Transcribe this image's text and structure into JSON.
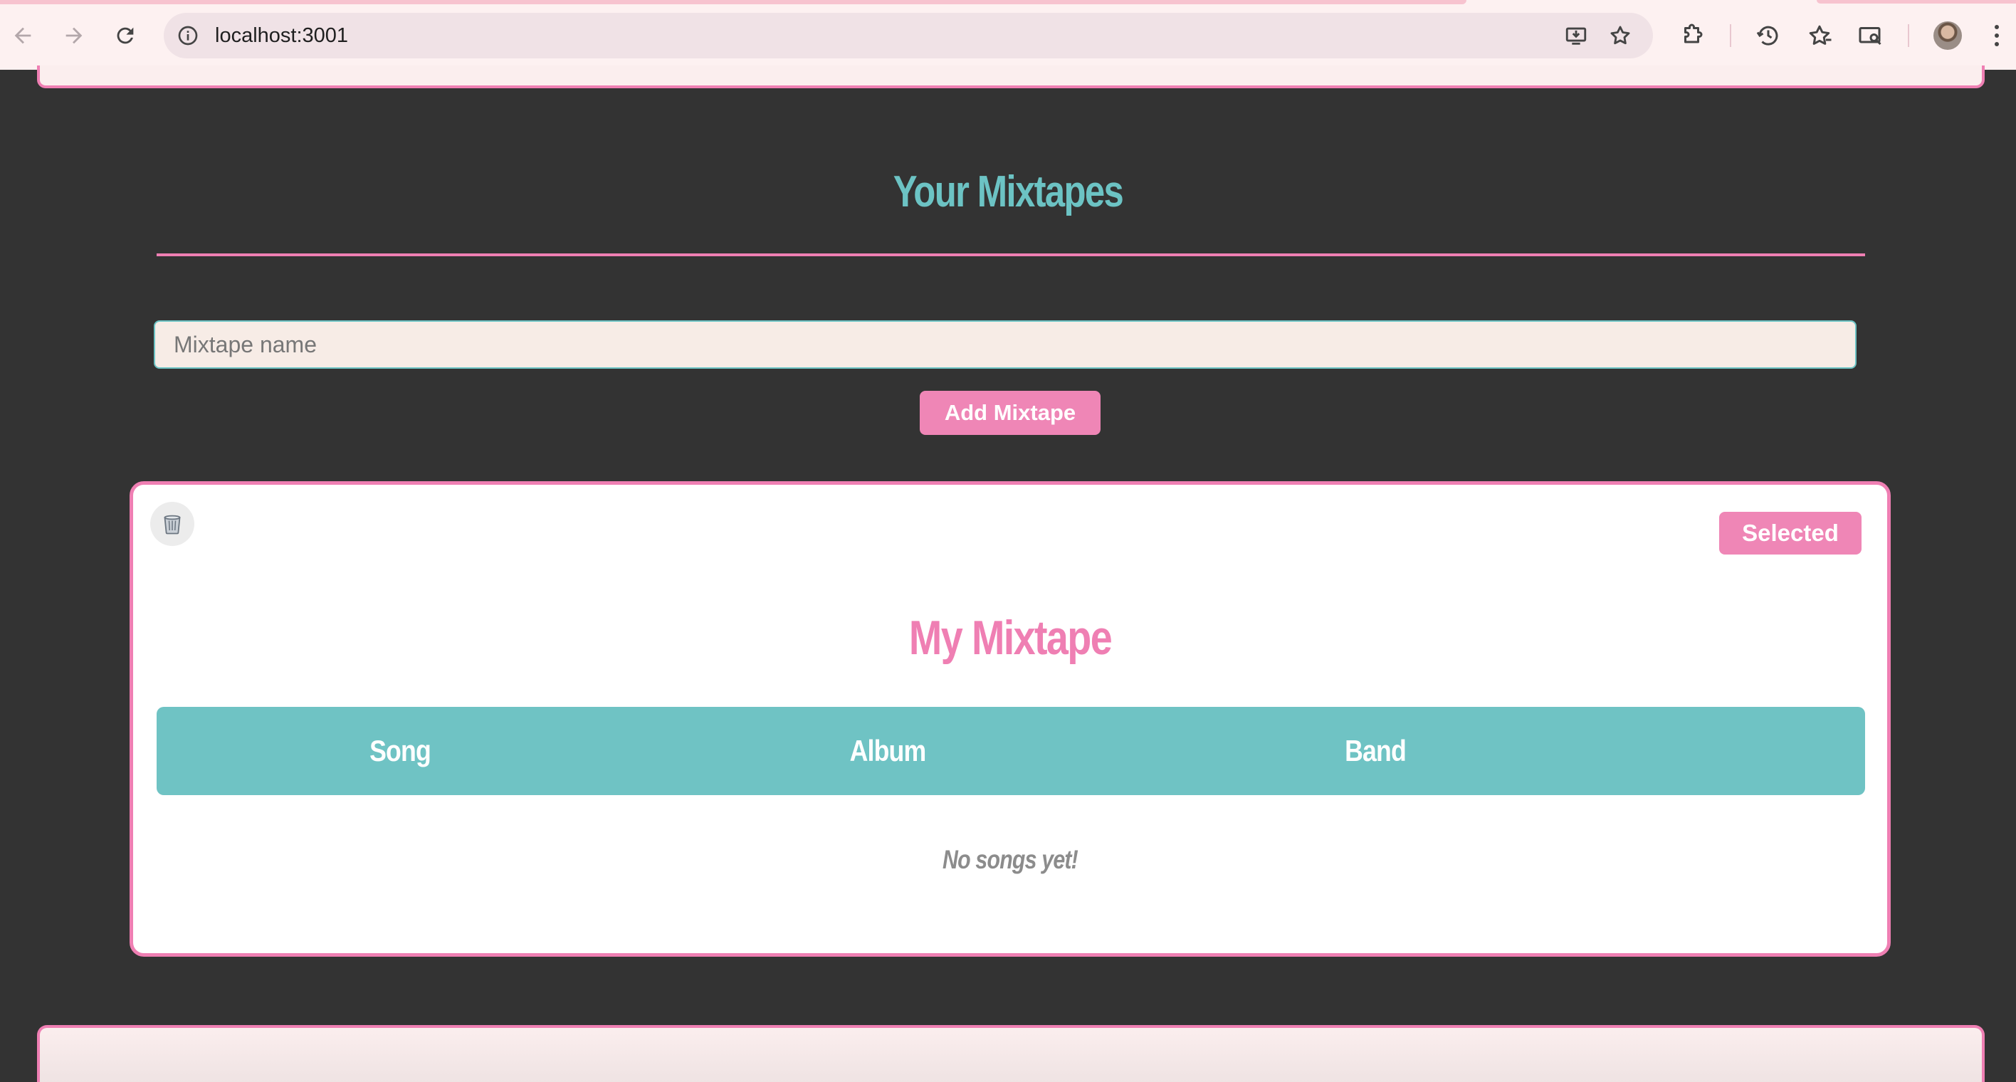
{
  "browser": {
    "url": "localhost:3001",
    "icons": {
      "back": "back-arrow-icon",
      "forward": "forward-arrow-icon",
      "reload": "reload-icon",
      "site_info": "site-info-icon",
      "install": "install-app-icon",
      "bookmark": "star-icon",
      "extensions": "puzzle-icon",
      "history": "history-icon",
      "reading": "bookmarks-star-icon",
      "tab_search": "tab-search-icon",
      "menu": "kebab-menu-icon"
    }
  },
  "mixtapes_section": {
    "title": "Your Mixtapes",
    "input_placeholder": "Mixtape name",
    "input_value": "",
    "add_button_label": "Add Mixtape"
  },
  "mixtape_card": {
    "delete_icon": "trash-icon",
    "selected_label": "Selected",
    "title": "My Mixtape",
    "columns": [
      "Song",
      "Album",
      "Band"
    ],
    "empty_message": "No songs yet!"
  },
  "colors": {
    "background": "#333333",
    "teal": "#6cc3c4",
    "pink": "#ef7fb3",
    "input_bg": "#f7ece6",
    "card_bg": "#ffffff"
  }
}
